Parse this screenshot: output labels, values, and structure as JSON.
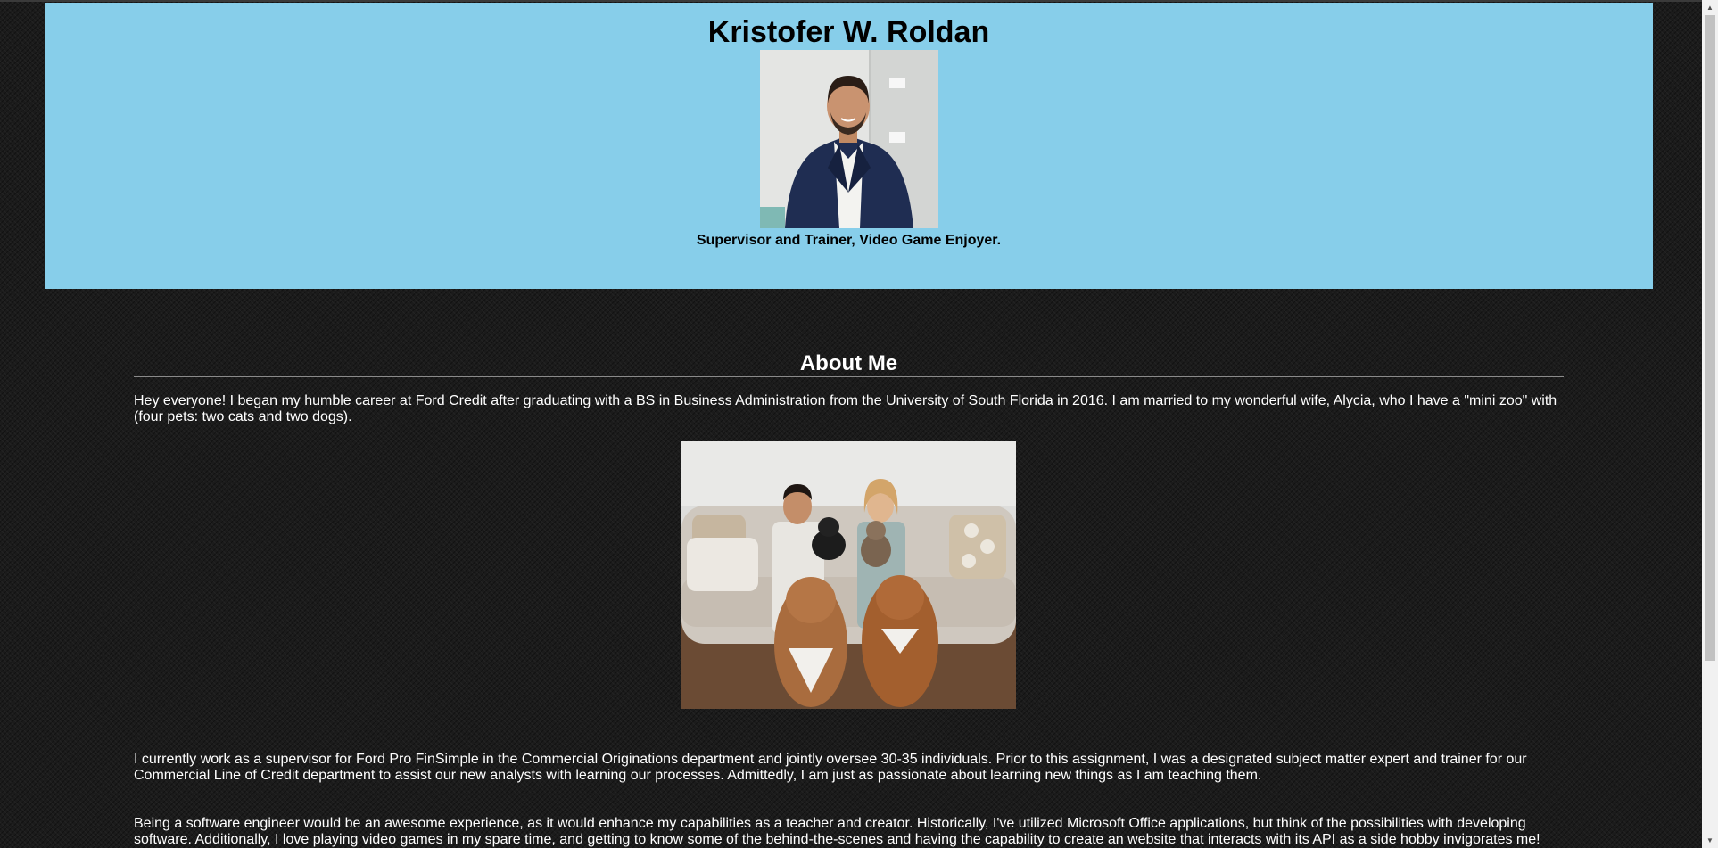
{
  "header": {
    "name": "Kristofer W. Roldan",
    "tagline": "Supervisor and Trainer, Video Game Enjoyer."
  },
  "about": {
    "title": "About Me",
    "paragraph1": "Hey everyone! I began my humble career at Ford Credit after graduating with a BS in Business Administration from the University of South Florida in 2016. I am married to my wonderful wife, Alycia, who I have a \"mini zoo\" with (four pets: two cats and two dogs).",
    "paragraph2": "I currently work as a supervisor for Ford Pro FinSimple in the Commercial Originations department and jointly oversee 30-35 individuals. Prior to this assignment, I was a designated subject matter expert and trainer for our Commercial Line of Credit department to assist our new analysts with learning our processes. Admittedly, I am just as passionate about learning new things as I am teaching them.",
    "paragraph3": "Being a software engineer would be an awesome experience, as it would enhance my capabilities as a teacher and creator. Historically, I've utilized Microsoft Office applications, but think of the possibilities with developing software. Additionally, I love playing video games in my spare time, and getting to know some of the behind-the-scenes and having the capability to create an website that interacts with its API as a side hobby invigorates me!"
  },
  "colors": {
    "header_bg": "#87ceea",
    "page_bg": "#1b1b1b",
    "text": "#ffffff"
  }
}
